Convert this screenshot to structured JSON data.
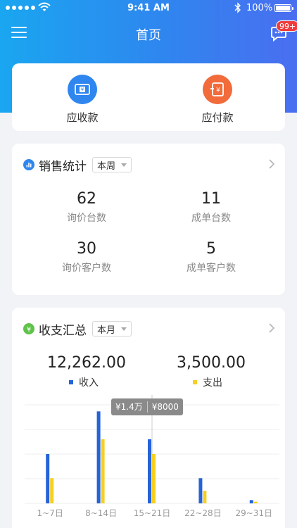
{
  "status_bar": {
    "time": "9:41 AM",
    "battery": "100%"
  },
  "nav": {
    "title": "首页",
    "badge": "99+"
  },
  "quick": {
    "receivable": {
      "label": "应收款",
      "color": "#2f86ef"
    },
    "payable": {
      "label": "应付款",
      "color": "#f26b3a"
    }
  },
  "sales": {
    "title": "销售统计",
    "period": "本周",
    "icon_color": "#2f86ef",
    "stats": [
      {
        "value": "62",
        "label": "询价台数"
      },
      {
        "value": "11",
        "label": "成单台数"
      },
      {
        "value": "30",
        "label": "询价客户数"
      },
      {
        "value": "5",
        "label": "成单客户数"
      }
    ]
  },
  "finance": {
    "title": "收支汇总",
    "period": "本月",
    "icon_color": "#5fc34a",
    "income_total": "12,262.00",
    "expense_total": "3,500.00",
    "income_label": "收入",
    "expense_label": "支出",
    "tooltip": {
      "income": "¥1.4万",
      "expense": "¥8000"
    }
  },
  "chart_data": {
    "type": "bar",
    "categories": [
      "1~7日",
      "8~14日",
      "15~21日",
      "22~28日",
      "29~31日"
    ],
    "series": [
      {
        "name": "收入",
        "color": "#2563d9",
        "values": [
          9000,
          16800,
          11700,
          4600,
          600
        ]
      },
      {
        "name": "支出",
        "color": "#f5d020",
        "values": [
          4600,
          11700,
          9000,
          2300,
          300
        ]
      }
    ],
    "ylim": [
      0,
      18000
    ],
    "grid": true,
    "highlight_index": 2
  }
}
